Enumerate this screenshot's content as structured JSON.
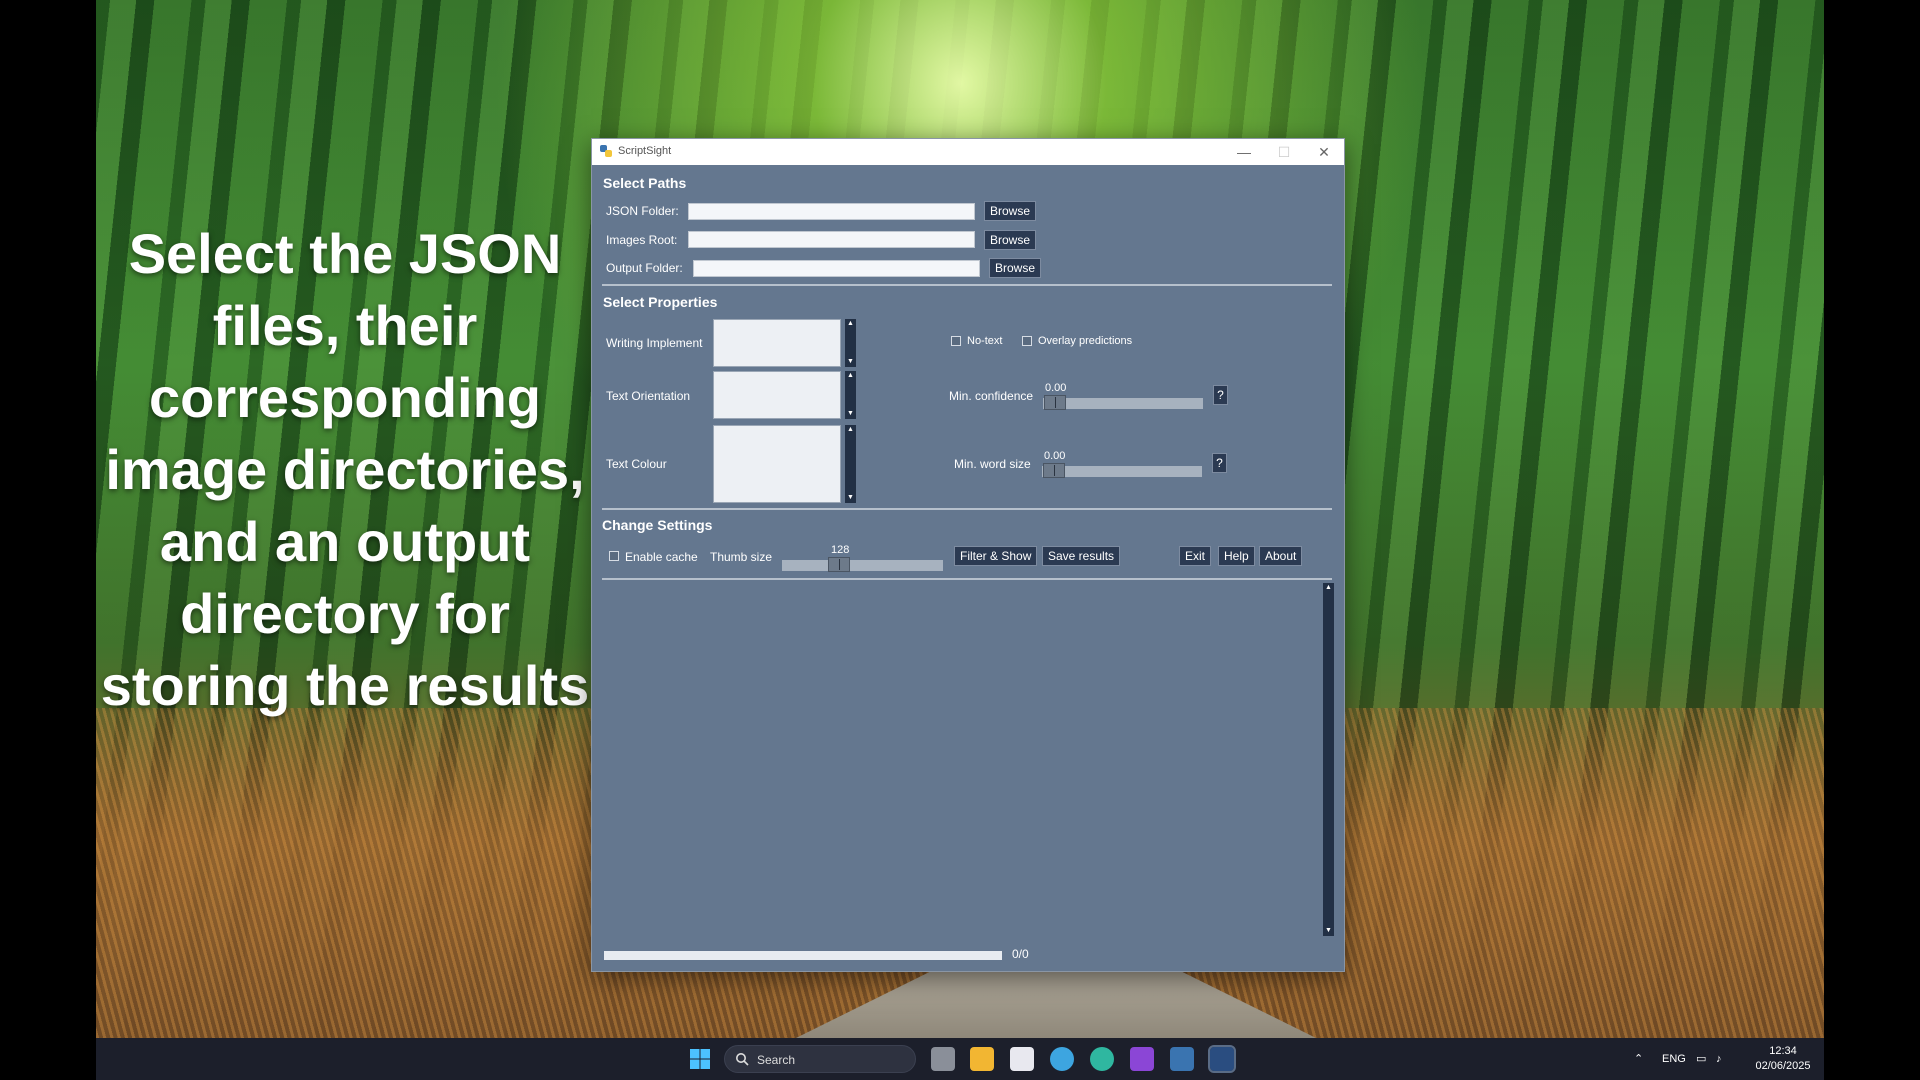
{
  "caption": "Select the JSON files, their corresponding image directories, and an output directory for storing the results",
  "window": {
    "title": "ScriptSight",
    "controls": {
      "minimize": "—",
      "maximize": "☐",
      "close": "✕"
    }
  },
  "paths": {
    "heading": "Select Paths",
    "json_label": "JSON Folder:",
    "images_label": "Images Root:",
    "output_label": "Output Folder:",
    "json_value": "",
    "images_value": "",
    "output_value": "",
    "browse_label": "Browse"
  },
  "properties": {
    "heading": "Select Properties",
    "writing_implement_label": "Writing Implement",
    "text_orientation_label": "Text Orientation",
    "text_colour_label": "Text Colour",
    "no_text_label": "No-text",
    "overlay_label": "Overlay predictions",
    "min_confidence_label": "Min. confidence",
    "min_confidence_value": "0.00",
    "min_word_size_label": "Min. word size",
    "min_word_size_value": "0.00",
    "help_symbol": "?"
  },
  "settings": {
    "heading": "Change Settings",
    "enable_cache_label": "Enable cache",
    "thumb_size_label": "Thumb size",
    "thumb_size_value": "128",
    "filter_show_label": "Filter & Show",
    "save_results_label": "Save results",
    "exit_label": "Exit",
    "help_label": "Help",
    "about_label": "About"
  },
  "progress": {
    "text": "0/0",
    "fraction": 0
  },
  "taskbar": {
    "search_label": "Search",
    "language": "ENG",
    "time": "12:34",
    "date": "02/06/2025",
    "icons": [
      "task-view-icon",
      "file-explorer-icon",
      "store-icon",
      "photos-icon",
      "edge-icon",
      "terminal-icon",
      "python-icon",
      "scriptsight-app-icon"
    ]
  },
  "colors": {
    "window_bg": "#64778f",
    "button_bg": "#2b3a52",
    "taskbar_bg": "#1c1f2b"
  }
}
